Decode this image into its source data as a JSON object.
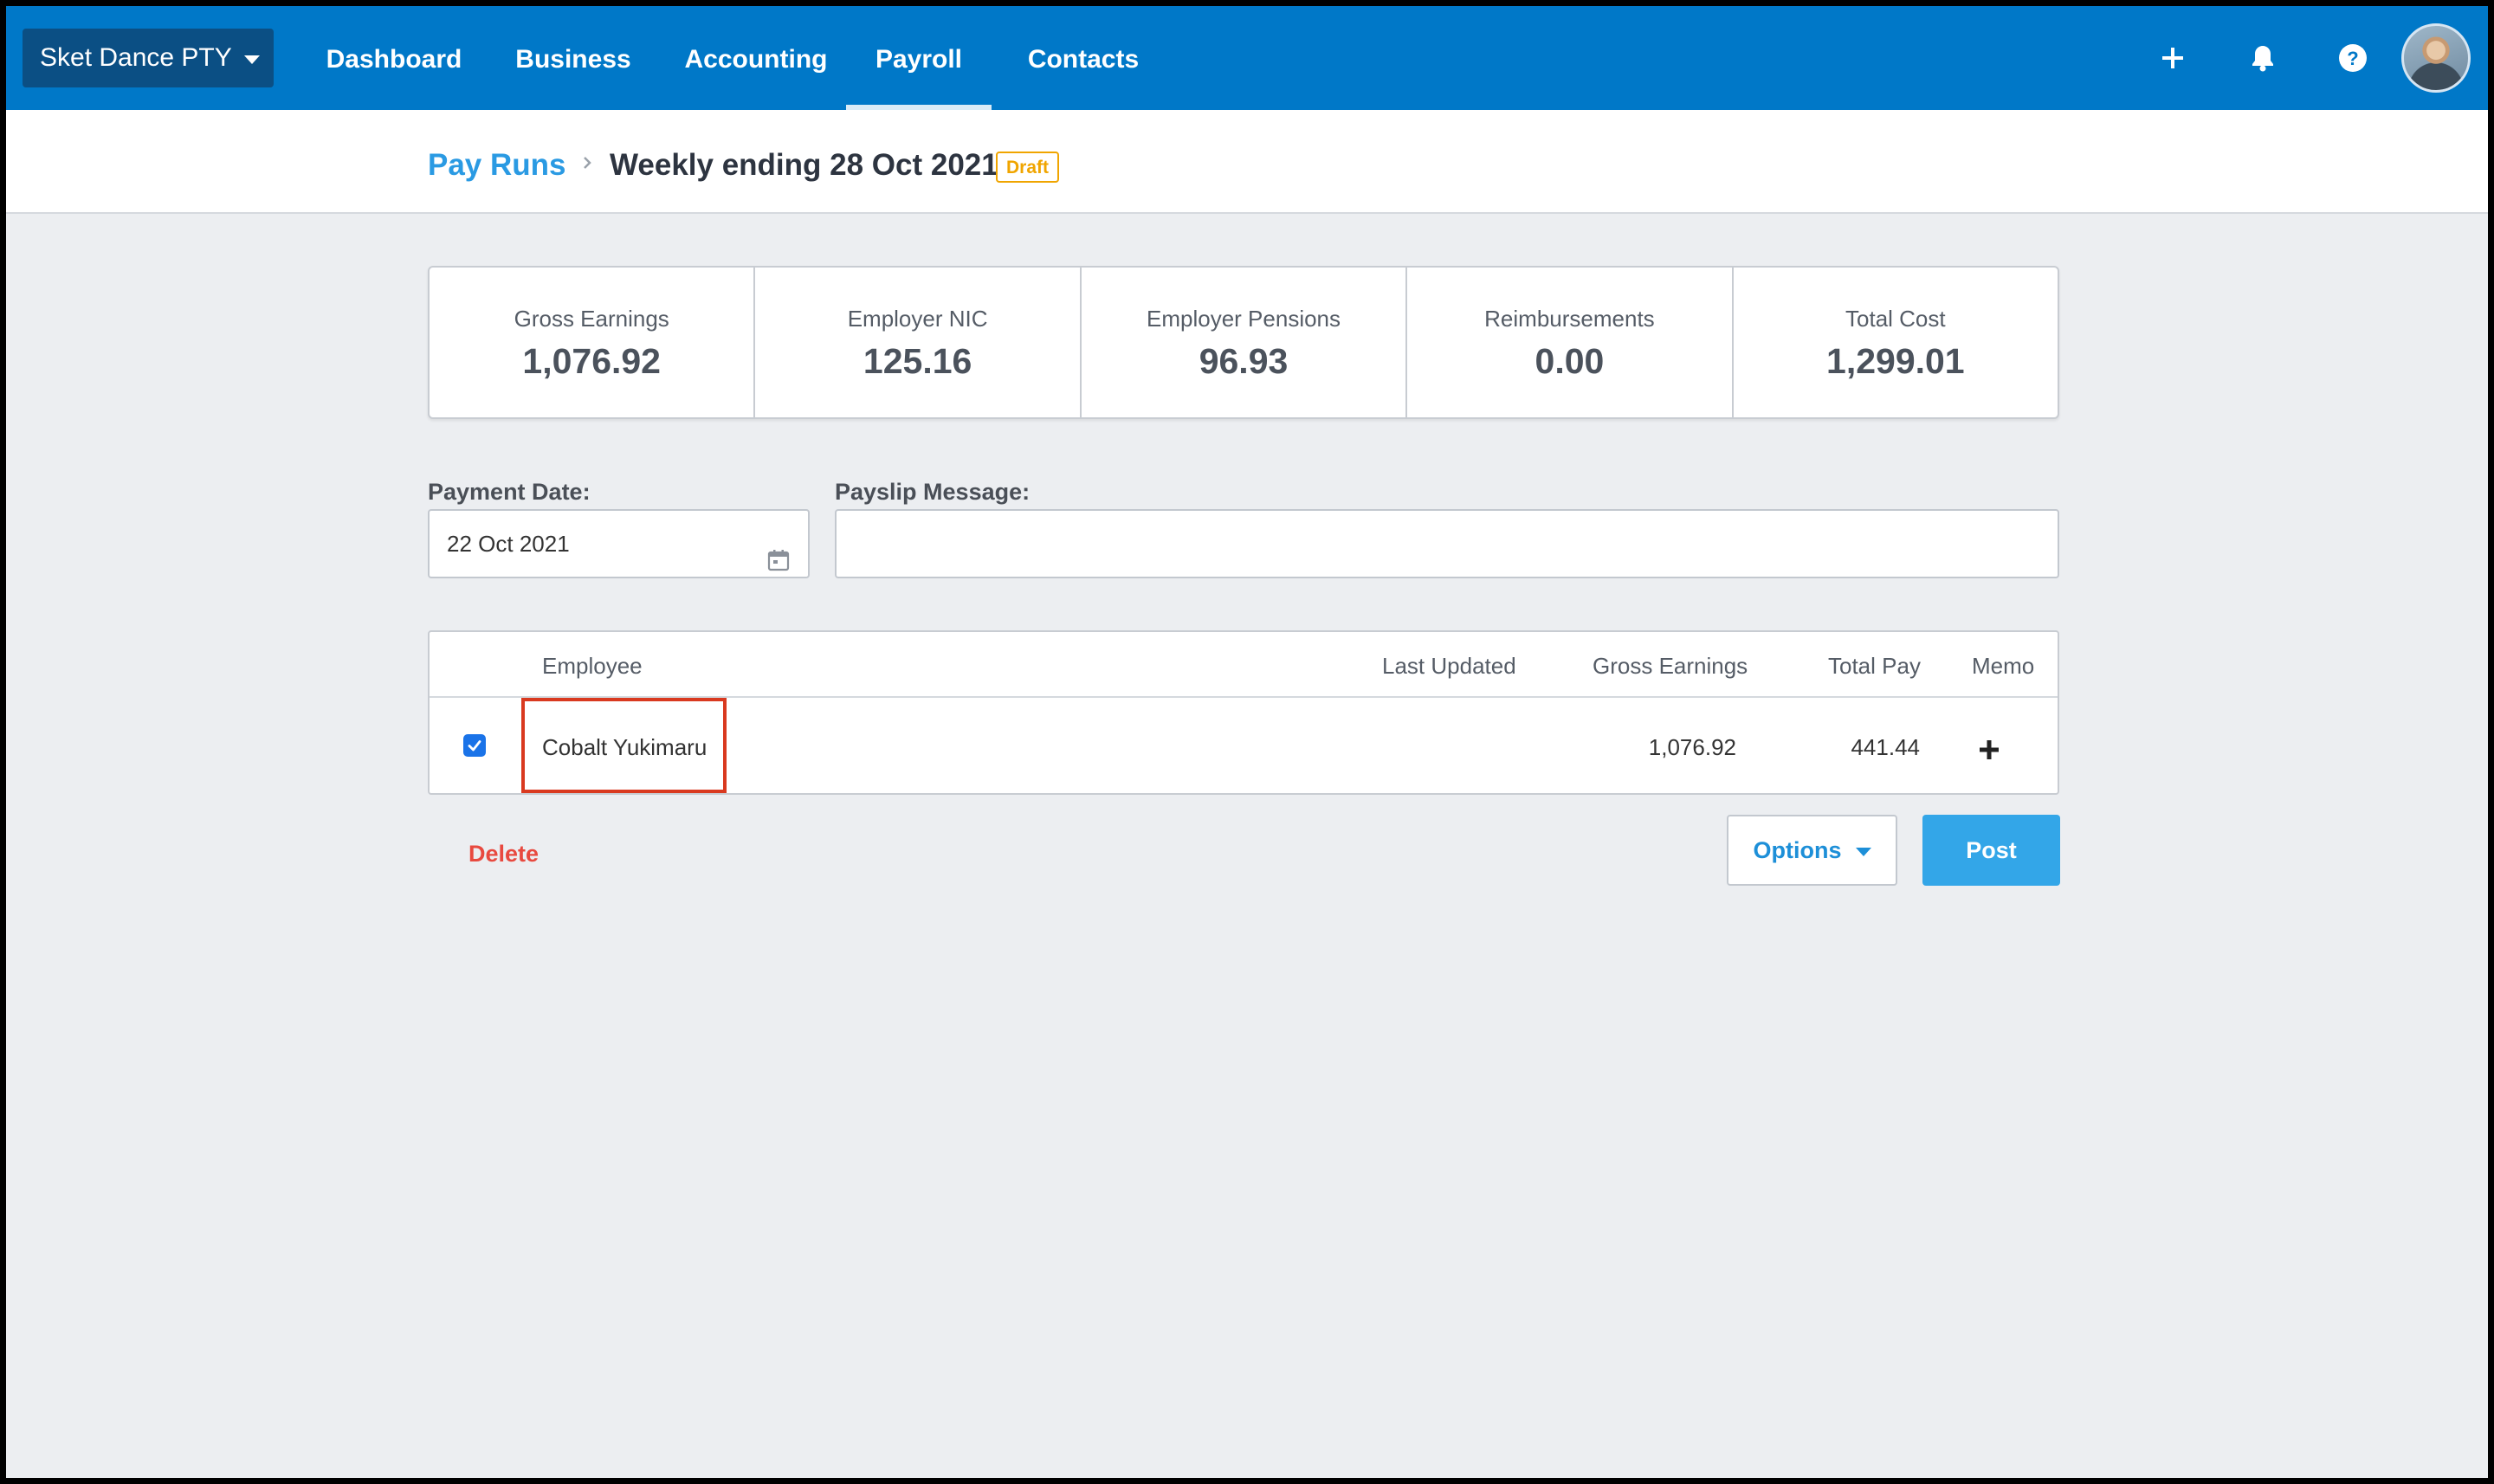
{
  "nav": {
    "org_name": "Sket Dance PTY",
    "items": [
      {
        "label": "Dashboard"
      },
      {
        "label": "Business"
      },
      {
        "label": "Accounting"
      },
      {
        "label": "Payroll",
        "active": true
      },
      {
        "label": "Contacts"
      }
    ],
    "icons": [
      "plus-icon",
      "bell-icon",
      "help-icon"
    ]
  },
  "breadcrumb": {
    "parent": "Pay Runs",
    "current": "Weekly ending 28 Oct 2021",
    "badge": "Draft"
  },
  "summary": [
    {
      "label": "Gross Earnings",
      "value": "1,076.92"
    },
    {
      "label": "Employer NIC",
      "value": "125.16"
    },
    {
      "label": "Employer Pensions",
      "value": "96.93"
    },
    {
      "label": "Reimbursements",
      "value": "0.00"
    },
    {
      "label": "Total Cost",
      "value": "1,299.01"
    }
  ],
  "form": {
    "payment_date_label": "Payment Date:",
    "payment_date_value": "22 Oct 2021",
    "payslip_message_label": "Payslip Message:",
    "payslip_message_value": ""
  },
  "table": {
    "headers": {
      "employee": "Employee",
      "last_updated": "Last Updated",
      "gross_earnings": "Gross Earnings",
      "total_pay": "Total Pay",
      "memo": "Memo"
    },
    "rows": [
      {
        "checked": true,
        "employee": "Cobalt Yukimaru",
        "last_updated": "",
        "gross_earnings": "1,076.92",
        "total_pay": "441.44"
      }
    ]
  },
  "actions": {
    "delete": "Delete",
    "options": "Options",
    "post": "Post"
  },
  "colors": {
    "nav_bg": "#0078c8",
    "link_blue": "#2a9ae3",
    "draft_orange": "#f0a500",
    "delete_red": "#e8493f",
    "post_blue": "#33a6e8",
    "highlight_red": "#d9391f"
  }
}
